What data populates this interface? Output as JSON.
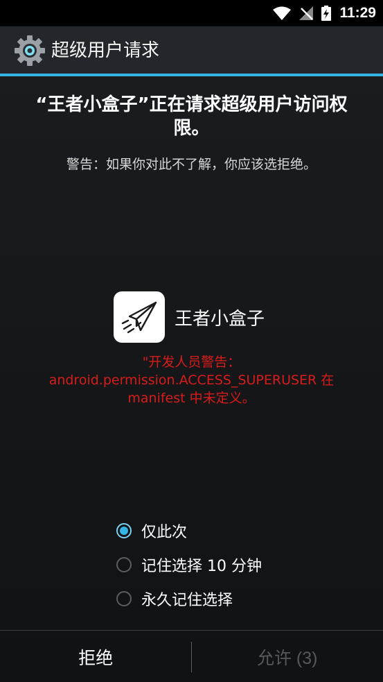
{
  "status_bar": {
    "time": "11:29",
    "icons": [
      "wifi-icon",
      "no-signal-icon",
      "battery-charging-icon"
    ]
  },
  "action_bar": {
    "icon": "gear-icon",
    "title": "超级用户请求"
  },
  "request": {
    "headline": "“王者小盒子”正在请求超级用户访问权限。",
    "warning": "警告：如果你对此不了解，你应该选拒绝。"
  },
  "app": {
    "icon": "paper-plane-icon",
    "name": "王者小盒子"
  },
  "developer_warning": {
    "line1": "\"开发人员警告：",
    "line2": "android.permission.ACCESS_SUPERUSER 在",
    "line3": "manifest 中未定义。"
  },
  "options": [
    {
      "label": "仅此次",
      "checked": true
    },
    {
      "label": "记住选择 10 分钟",
      "checked": false
    },
    {
      "label": "永久记住选择",
      "checked": false
    }
  ],
  "buttons": {
    "deny": "拒绝",
    "allow": "允许 (3)"
  },
  "colors": {
    "accent": "#33b5e5",
    "warning_red": "#d81c1c",
    "disabled_text": "#55585c"
  }
}
